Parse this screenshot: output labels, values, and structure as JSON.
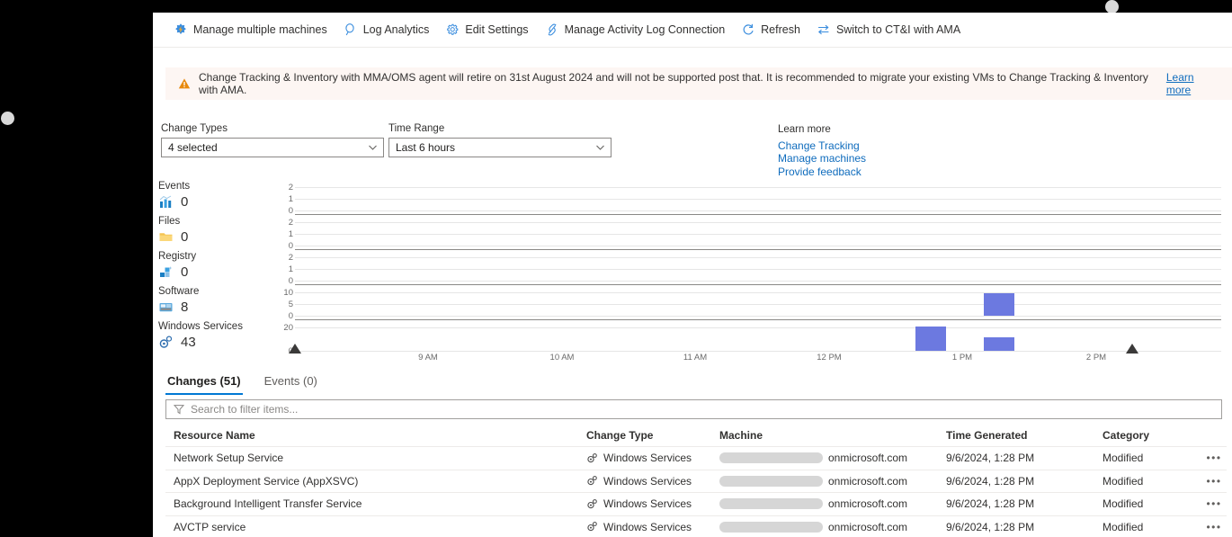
{
  "chrome": {
    "handle_left": "drag-handle",
    "handle_top": "drag-handle"
  },
  "toolbar": {
    "items": [
      {
        "label": "Manage multiple machines",
        "icon": "manage-machines-icon"
      },
      {
        "label": "Log Analytics",
        "icon": "log-analytics-icon"
      },
      {
        "label": "Edit Settings",
        "icon": "gear-icon"
      },
      {
        "label": "Manage Activity Log Connection",
        "icon": "link-icon"
      },
      {
        "label": "Refresh",
        "icon": "refresh-icon"
      },
      {
        "label": "Switch to CT&I with AMA",
        "icon": "switch-icon"
      }
    ]
  },
  "banner": {
    "icon": "warning-icon",
    "text": "Change Tracking & Inventory with MMA/OMS agent will retire on 31st August 2024 and will not be supported post that. It is recommended to migrate your existing VMs to Change Tracking & Inventory with AMA.",
    "link": "Learn more"
  },
  "filters": {
    "change_types": {
      "label": "Change Types",
      "value": "4 selected"
    },
    "time_range": {
      "label": "Time Range",
      "value": "Last 6 hours"
    }
  },
  "learn_more": {
    "title": "Learn more",
    "links": [
      "Change Tracking",
      "Manage machines",
      "Provide feedback"
    ]
  },
  "chart_data": {
    "type": "bar",
    "title": "",
    "xlabel": "",
    "ylabel": "",
    "grid": true,
    "legend": "none",
    "bar_color": "#6c79e0",
    "x_ticks": [
      "9 AM",
      "10 AM",
      "11 AM",
      "12 PM",
      "1 PM",
      "2 PM"
    ],
    "panels": [
      {
        "name": "Events",
        "count": "0",
        "icon": "events-icon",
        "yticks": [
          "2",
          "1",
          "0"
        ],
        "ylim": [
          0,
          2
        ],
        "values": []
      },
      {
        "name": "Files",
        "count": "0",
        "icon": "folder-icon",
        "yticks": [
          "2",
          "1",
          "0"
        ],
        "ylim": [
          0,
          2
        ],
        "values": []
      },
      {
        "name": "Registry",
        "count": "0",
        "icon": "registry-icon",
        "yticks": [
          "2",
          "1",
          "0"
        ],
        "ylim": [
          0,
          2
        ],
        "values": []
      },
      {
        "name": "Software",
        "count": "8",
        "icon": "software-icon",
        "yticks": [
          "10",
          "5",
          "0"
        ],
        "ylim": [
          0,
          10
        ],
        "values": [
          {
            "time": "1:05 PM",
            "value": 8
          }
        ]
      },
      {
        "name": "Windows Services",
        "count": "43",
        "icon": "services-icon",
        "yticks": [
          "20",
          "0"
        ],
        "ylim": [
          0,
          20
        ],
        "values": [
          {
            "time": "12:50 PM",
            "value": 21
          },
          {
            "time": "1:05 PM",
            "value": 11
          }
        ]
      }
    ]
  },
  "tabs": [
    {
      "label": "Changes (51)",
      "active": true
    },
    {
      "label": "Events (0)",
      "active": false
    }
  ],
  "search": {
    "icon": "filter-icon",
    "placeholder": "Search to filter items..."
  },
  "table": {
    "columns": [
      "Resource Name",
      "Change Type",
      "Machine",
      "Time Generated",
      "Category"
    ],
    "rows": [
      {
        "resource": "Network Setup Service",
        "type": "Windows Services",
        "machine_redacted": true,
        "machine_suffix": "onmicrosoft.com",
        "time": "9/6/2024, 1:28 PM",
        "category": "Modified",
        "more": "•••"
      },
      {
        "resource": "AppX Deployment Service (AppXSVC)",
        "type": "Windows Services",
        "machine_redacted": true,
        "machine_suffix": "onmicrosoft.com",
        "time": "9/6/2024, 1:28 PM",
        "category": "Modified",
        "more": "•••"
      },
      {
        "resource": "Background Intelligent Transfer Service",
        "type": "Windows Services",
        "machine_redacted": true,
        "machine_suffix": "onmicrosoft.com",
        "time": "9/6/2024, 1:28 PM",
        "category": "Modified",
        "more": "•••"
      },
      {
        "resource": "AVCTP service",
        "type": "Windows Services",
        "machine_redacted": true,
        "machine_suffix": "onmicrosoft.com",
        "time": "9/6/2024, 1:28 PM",
        "category": "Modified",
        "more": "•••"
      }
    ]
  },
  "colors": {
    "accent": "#0078d4",
    "link": "#0f6cbd",
    "bar": "#6c79e0",
    "warning": "#e8890c"
  }
}
